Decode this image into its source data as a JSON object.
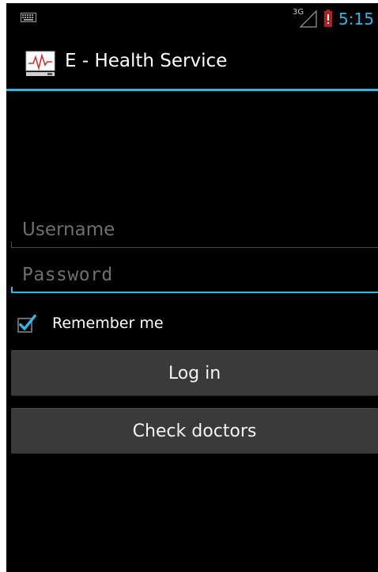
{
  "status_bar": {
    "network_type": "3G",
    "time": "5:15",
    "icons": [
      "keyboard-icon",
      "signal-icon",
      "battery-alert-icon"
    ],
    "clock_color": "#33b5e5"
  },
  "action_bar": {
    "title": "E - Health Service",
    "icon": "heart-monitor-icon",
    "accent_color": "#33b5e5"
  },
  "login_form": {
    "username": {
      "value": "",
      "placeholder": "Username"
    },
    "password": {
      "value": "",
      "placeholder": "Password",
      "focused": true
    },
    "remember_me": {
      "label": "Remember me",
      "checked": true
    },
    "login_button": "Log in",
    "check_doctors_button": "Check doctors"
  }
}
